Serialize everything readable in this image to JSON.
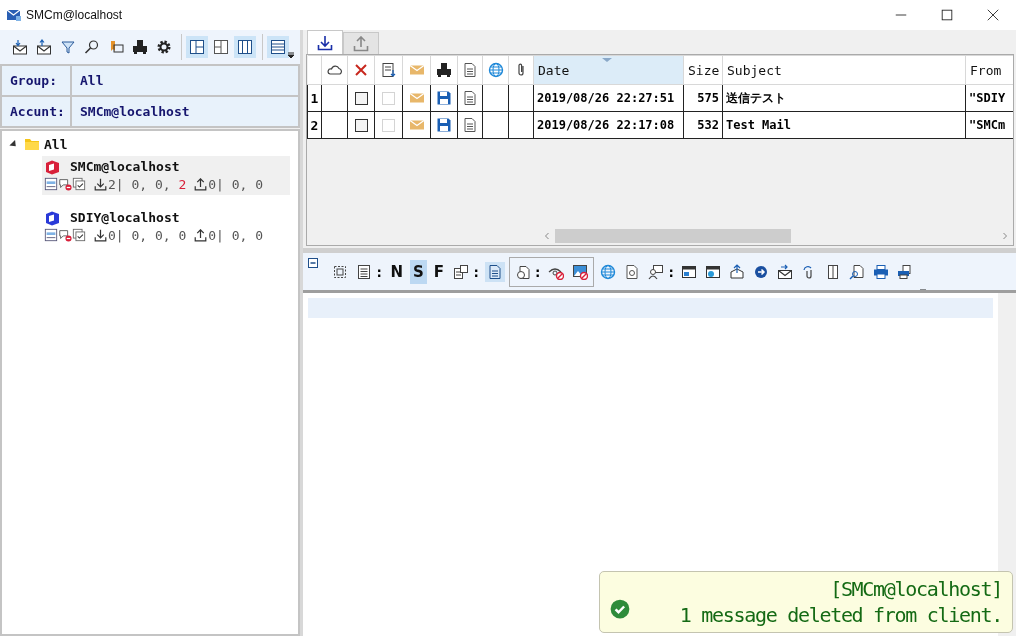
{
  "window": {
    "title": "SMCm@localhost"
  },
  "toolbar": [
    {
      "kind": "receive",
      "selected": false
    },
    {
      "kind": "send",
      "selected": false
    },
    {
      "kind": "funnel",
      "selected": false
    },
    {
      "kind": "find",
      "selected": false
    },
    {
      "kind": "bookmark",
      "selected": false
    },
    {
      "kind": "fax",
      "selected": false
    },
    {
      "kind": "gear",
      "selected": false
    },
    {
      "kind": "sep"
    },
    {
      "kind": "layout1",
      "selected": true
    },
    {
      "kind": "layout2",
      "selected": false
    },
    {
      "kind": "layout3",
      "selected": true
    },
    {
      "kind": "sep"
    },
    {
      "kind": "list",
      "selected": true
    }
  ],
  "filters": [
    {
      "label": "Group:",
      "value": "All"
    },
    {
      "label": "Accunt:",
      "value": "SMCm@localhost"
    }
  ],
  "tree": {
    "label": "All",
    "expanded": true,
    "children": [
      {
        "name": "SMCm@localhost",
        "color": "#d8203a",
        "selected": true,
        "received": [
          {
            "text": "2| 0, 0, ",
            "alert": false
          },
          {
            "text": "2",
            "alert": true
          }
        ],
        "sent": [
          {
            "text": "0| 0, 0",
            "alert": false
          }
        ]
      },
      {
        "name": "SDIY@localhost",
        "color": "#2a3ad8",
        "selected": false,
        "received": [
          {
            "text": "0| 0, 0, ",
            "alert": false
          },
          {
            "text": "0",
            "alert": false
          }
        ],
        "sent": [
          {
            "text": "0| 0, 0",
            "alert": false
          }
        ]
      }
    ]
  },
  "tabs": [
    {
      "kind": "receive",
      "selected": true
    },
    {
      "kind": "send",
      "selected": false
    }
  ],
  "table": {
    "columns": [
      {
        "kind": "cloud"
      },
      {
        "kind": "delete"
      },
      {
        "kind": "download"
      },
      {
        "kind": "envelope"
      },
      {
        "kind": "fax"
      },
      {
        "kind": "document"
      },
      {
        "kind": "globe"
      },
      {
        "kind": "clip"
      },
      {
        "kind": "text",
        "label": "Date",
        "sorted": true
      },
      {
        "kind": "text",
        "label": "Size",
        "sorted": false
      },
      {
        "kind": "text",
        "label": "Subject",
        "sorted": false
      },
      {
        "kind": "text",
        "label": "From",
        "sorted": false
      }
    ],
    "rows": [
      {
        "number": "1",
        "delete_checked": false,
        "mark_checked": false,
        "mark_disabled": true,
        "date": "2019/08/26 22:27:51",
        "size": "575",
        "subject": "送信テスト",
        "from": "\"SDIY"
      },
      {
        "number": "2",
        "delete_checked": false,
        "mark_checked": false,
        "mark_disabled": true,
        "date": "2019/08/26 22:17:08",
        "size": "532",
        "subject": "Test Mail",
        "from": "\"SMCm"
      }
    ]
  },
  "view_toolbar": [
    {
      "kind": "frame",
      "selected": false
    },
    {
      "kind": "lines",
      "selected": false
    },
    {
      "kind": "text",
      "label": ":"
    },
    {
      "kind": "text",
      "label": "N",
      "selected": false
    },
    {
      "kind": "text",
      "label": "S",
      "selected": true
    },
    {
      "kind": "text",
      "label": "F",
      "selected": false
    },
    {
      "kind": "docs",
      "selected": false
    },
    {
      "kind": "text",
      "label": ":"
    },
    {
      "kind": "doc",
      "selected": true
    },
    {
      "kind": "group",
      "children": [
        {
          "kind": "attach",
          "selected": false
        },
        {
          "kind": "text",
          "label": ":"
        },
        {
          "kind": "eyeoff",
          "selected": false
        },
        {
          "kind": "imageoff",
          "selected": false
        }
      ]
    },
    {
      "kind": "globe",
      "selected": false
    },
    {
      "kind": "seal",
      "selected": false
    },
    {
      "kind": "contact",
      "selected": false
    },
    {
      "kind": "text",
      "label": ":"
    },
    {
      "kind": "window",
      "selected": false
    },
    {
      "kind": "webwindow",
      "selected": false
    },
    {
      "kind": "boxup",
      "selected": false
    },
    {
      "kind": "forward",
      "selected": false
    },
    {
      "kind": "envin",
      "selected": false
    },
    {
      "kind": "attachcycle",
      "selected": false
    },
    {
      "kind": "pages",
      "selected": false
    },
    {
      "kind": "searchdoc",
      "selected": false
    },
    {
      "kind": "printer",
      "selected": false
    },
    {
      "kind": "printer2",
      "selected": false
    }
  ],
  "toast": {
    "title": "[SMCm@localhost]",
    "message": "1 message deleted from client."
  }
}
